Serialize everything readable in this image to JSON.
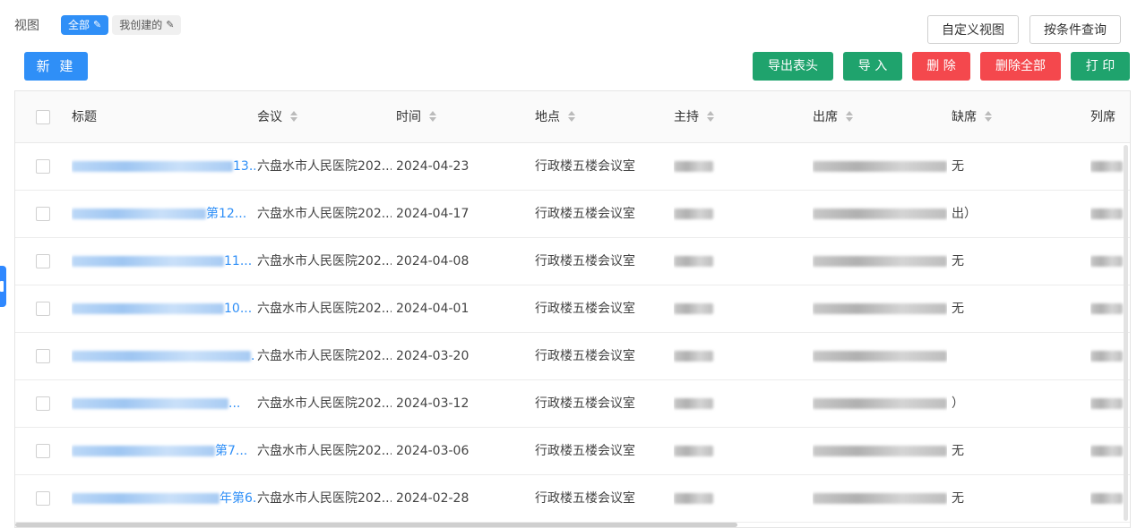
{
  "views": {
    "label": "视图",
    "chips": [
      {
        "label": "全部",
        "active": true
      },
      {
        "label": "我创建的",
        "active": false
      }
    ],
    "pen_icon": "✎"
  },
  "toolbar": {
    "custom_view": "自定义视图",
    "condition_query": "按条件查询",
    "new": "新 建",
    "export_header": "导出表头",
    "import": "导 入",
    "delete": "删 除",
    "delete_all": "删除全部",
    "print": "打 印"
  },
  "colors": {
    "primary": "#2f8ff7",
    "green": "#1fa36d",
    "red": "#f4484d"
  },
  "table": {
    "columns": [
      "标题",
      "会议",
      "时间",
      "地点",
      "主持",
      "出席",
      "缺席",
      "列席"
    ],
    "rows": [
      {
        "title": "六盘…13…",
        "title_suffix": "13...",
        "meeting": "六盘水市人民医院202...",
        "time": "2024-04-23",
        "place": "行政楼五楼会议室",
        "absent": "无"
      },
      {
        "title_suffix": "第12...",
        "meeting": "六盘水市人民医院202...",
        "time": "2024-04-17",
        "place": "行政楼五楼会议室",
        "absent": "出）"
      },
      {
        "title_suffix": "11...",
        "meeting": "六盘水市人民医院202...",
        "time": "2024-04-08",
        "place": "行政楼五楼会议室",
        "absent": "无"
      },
      {
        "title_suffix": "10...",
        "meeting": "六盘水市人民医院202...",
        "time": "2024-04-01",
        "place": "行政楼五楼会议室",
        "absent": "无"
      },
      {
        "title_suffix": "...",
        "meeting": "六盘水市人民医院202...",
        "time": "2024-03-20",
        "place": "行政楼五楼会议室",
        "absent": ""
      },
      {
        "title_suffix": "...",
        "meeting": "六盘水市人民医院202...",
        "time": "2024-03-12",
        "place": "行政楼五楼会议室",
        "absent": "）"
      },
      {
        "title_suffix": "第7...",
        "meeting": "六盘水市人民医院202...",
        "time": "2024-03-06",
        "place": "行政楼五楼会议室",
        "absent": "无"
      },
      {
        "title_suffix": "年第6...",
        "meeting": "六盘水市人民医院202...",
        "time": "2024-02-28",
        "place": "行政楼五楼会议室",
        "absent": "无"
      }
    ]
  }
}
